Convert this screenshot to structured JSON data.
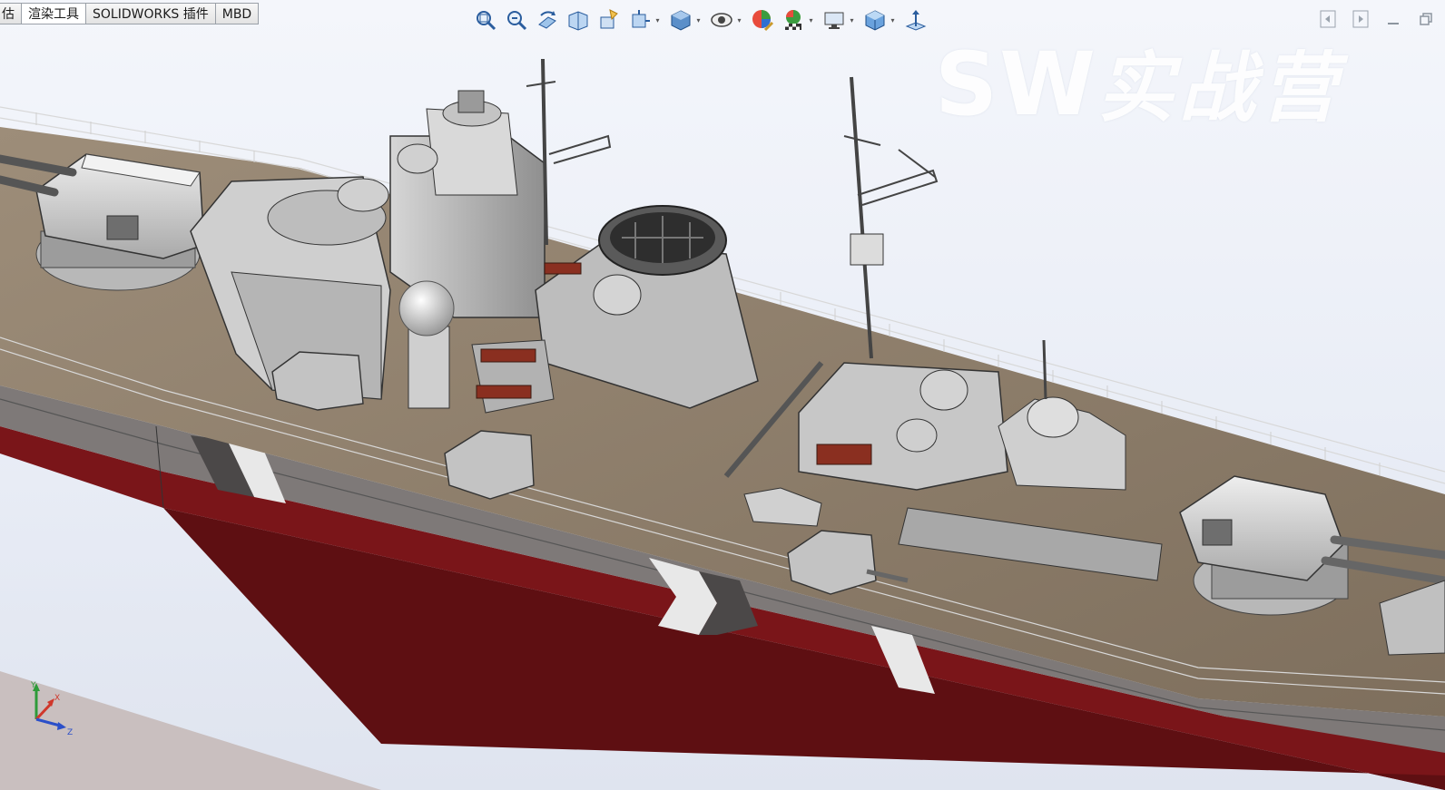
{
  "app": {
    "name": "SOLIDWORKS"
  },
  "tabs": [
    {
      "label": "估",
      "active": false
    },
    {
      "label": "渲染工具",
      "active": true
    },
    {
      "label": "SOLIDWORKS 插件",
      "active": false
    },
    {
      "label": "MBD",
      "active": false
    }
  ],
  "hud_toolbar": [
    {
      "icon": "zoom-to-fit-icon",
      "dropdown": false
    },
    {
      "icon": "zoom-to-area-icon",
      "dropdown": false
    },
    {
      "icon": "previous-view-icon",
      "dropdown": false
    },
    {
      "icon": "section-view-icon",
      "dropdown": false
    },
    {
      "icon": "dynamic-annotation-views-icon",
      "dropdown": false
    },
    {
      "icon": "view-orientation-icon",
      "dropdown": true
    },
    {
      "icon": "display-style-icon",
      "dropdown": true
    },
    {
      "icon": "hide-show-items-icon",
      "dropdown": true
    },
    {
      "icon": "edit-appearance-icon",
      "dropdown": false
    },
    {
      "icon": "apply-scene-icon",
      "dropdown": true
    },
    {
      "icon": "view-settings-icon",
      "dropdown": true
    },
    {
      "icon": "view-cube-icon",
      "dropdown": true
    },
    {
      "icon": "normal-to-icon",
      "dropdown": false
    }
  ],
  "window_controls": [
    {
      "icon": "tile-left-icon"
    },
    {
      "icon": "tile-right-icon"
    },
    {
      "icon": "minimize-icon"
    },
    {
      "icon": "restore-icon"
    }
  ],
  "watermark": {
    "latin": "SW",
    "cn": "实战营"
  },
  "triad": {
    "x": "X",
    "y": "Y",
    "z": "Z"
  },
  "colors": {
    "background_top": "#f4f6fb",
    "deck": "#8a7a67",
    "hull_upper": "#7d7877",
    "hull_lower": "#7a1519",
    "superstructure": "#c9c9c9"
  }
}
